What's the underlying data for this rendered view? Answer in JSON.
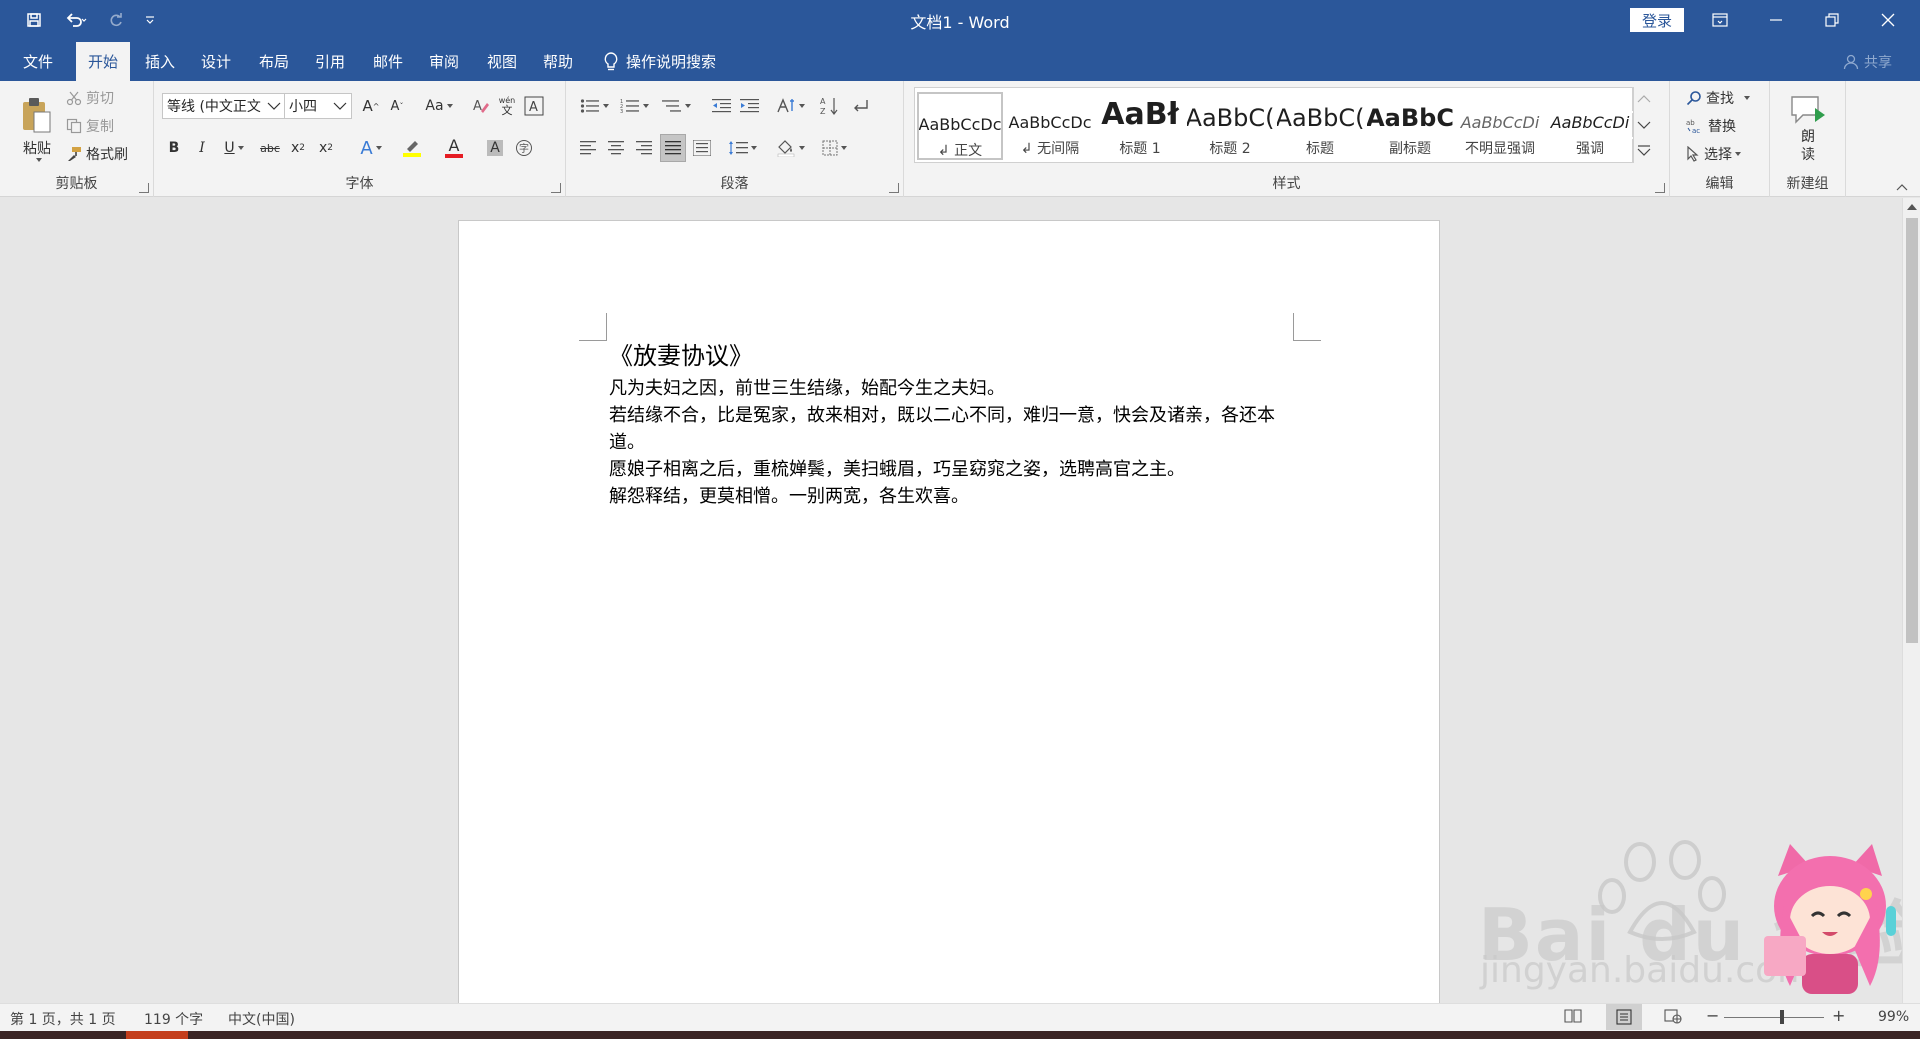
{
  "window": {
    "title": "文档1  -  Word",
    "login_label": "登录"
  },
  "tabs": [
    {
      "label": "文件"
    },
    {
      "label": "开始"
    },
    {
      "label": "插入"
    },
    {
      "label": "设计"
    },
    {
      "label": "布局"
    },
    {
      "label": "引用"
    },
    {
      "label": "邮件"
    },
    {
      "label": "审阅"
    },
    {
      "label": "视图"
    },
    {
      "label": "帮助"
    }
  ],
  "tell_me": "操作说明搜索",
  "share_label": "共享",
  "clipboard": {
    "paste": "粘贴",
    "cut": "剪切",
    "copy": "复制",
    "format_painter": "格式刷",
    "group_label": "剪贴板"
  },
  "font": {
    "name": "等线 (中文正文",
    "size": "小四",
    "group_label": "字体"
  },
  "paragraph": {
    "group_label": "段落"
  },
  "styles": {
    "items": [
      {
        "preview": "AaBbCcDc",
        "name": "↲ 正文"
      },
      {
        "preview": "AaBbCcDc",
        "name": "↲ 无间隔"
      },
      {
        "preview": "AaBł",
        "name": "标题 1"
      },
      {
        "preview": "AaBbC(",
        "name": "标题 2"
      },
      {
        "preview": "AaBbC(",
        "name": "标题"
      },
      {
        "preview": "AaBbC",
        "name": "副标题"
      },
      {
        "preview": "AaBbCcDi",
        "name": "不明显强调"
      },
      {
        "preview": "AaBbCcDi",
        "name": "强调"
      }
    ],
    "group_label": "样式"
  },
  "editing": {
    "find": "查找",
    "replace": "替换",
    "select": "选择",
    "group_label": "编辑"
  },
  "newgroup": {
    "read_aloud_line1": "朗",
    "read_aloud_line2": "读",
    "group_label": "新建组"
  },
  "document": {
    "heading": "《放妻协议》",
    "paragraphs": [
      "凡为夫妇之因，前世三生结缘，始配今生之夫妇。",
      "若结缘不合，比是冤家，故来相对，既以二心不同，难归一意，快会及诸亲，各还本道。",
      "愿娘子相离之后，重梳婵鬓，美扫蛾眉，巧呈窈窕之姿，选聘高官之主。",
      "解怨释结，更莫相憎。一别两宽，各生欢喜。"
    ]
  },
  "status": {
    "page": "第 1 页，共 1 页",
    "words": "119 个字",
    "language": "中文(中国)",
    "zoom": "99%"
  },
  "watermark": {
    "text": "Bai du 经验",
    "url": "jingyan.baidu.com"
  },
  "colors": {
    "accent": "#2b579a",
    "font_color_bar": "#e51c23",
    "highlight_bar": "#ffff00"
  }
}
